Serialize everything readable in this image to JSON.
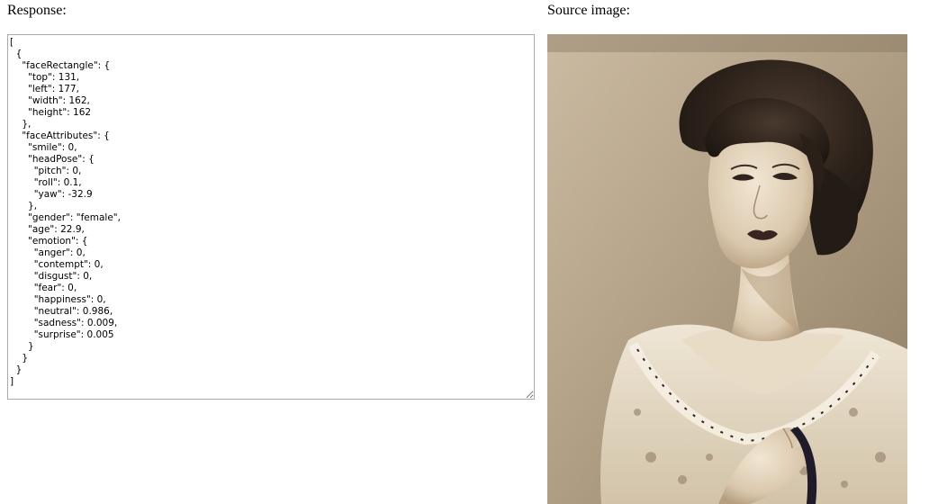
{
  "headings": {
    "response": "Response:",
    "source": "Source image:"
  },
  "response_json": "[\n  {\n    \"faceRectangle\": {\n      \"top\": 131,\n      \"left\": 177,\n      \"width\": 162,\n      \"height\": 162\n    },\n    \"faceAttributes\": {\n      \"smile\": 0,\n      \"headPose\": {\n        \"pitch\": 0,\n        \"roll\": 0.1,\n        \"yaw\": -32.9\n      },\n      \"gender\": \"female\",\n      \"age\": 22.9,\n      \"emotion\": {\n        \"anger\": 0,\n        \"contempt\": 0,\n        \"disgust\": 0,\n        \"fear\": 0,\n        \"happiness\": 0,\n        \"neutral\": 0.986,\n        \"sadness\": 0.009,\n        \"surprise\": 0.005\n      }\n    }\n  }\n]",
  "source_image": {
    "subject": "sepia portrait photograph of a woman with short dark curly hair wearing a lace floral blouse"
  },
  "colors": {
    "textarea_border": "#a9a9a9",
    "sepia_light": "#d9ccb6",
    "sepia_dark": "#2a211b"
  }
}
